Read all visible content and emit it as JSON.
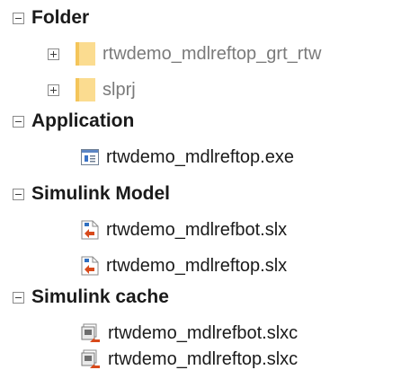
{
  "tree": {
    "groups": [
      {
        "label": "Folder",
        "expanded": true,
        "items": [
          {
            "label": "rtwdemo_mdlreftop_grt_rtw",
            "icon": "folder-icon",
            "expandable": true,
            "dimmed": true
          },
          {
            "label": "slprj",
            "icon": "folder-icon",
            "expandable": true,
            "dimmed": true
          }
        ]
      },
      {
        "label": "Application",
        "expanded": true,
        "items": [
          {
            "label": "rtwdemo_mdlreftop.exe",
            "icon": "application-icon",
            "expandable": false
          }
        ]
      },
      {
        "label": "Simulink Model",
        "expanded": true,
        "items": [
          {
            "label": "rtwdemo_mdlrefbot.slx",
            "icon": "simulink-model-icon",
            "expandable": false
          },
          {
            "label": "rtwdemo_mdlreftop.slx",
            "icon": "simulink-model-icon",
            "expandable": false
          }
        ]
      },
      {
        "label": "Simulink cache",
        "expanded": true,
        "items": [
          {
            "label": "rtwdemo_mdlrefbot.slxc",
            "icon": "simulink-cache-icon",
            "expandable": false
          },
          {
            "label": "rtwdemo_mdlreftop.slxc",
            "icon": "simulink-cache-icon",
            "expandable": false
          }
        ]
      }
    ],
    "colors": {
      "folder": "#fbdc90",
      "dimmed_text": "#7a7a7a",
      "model_arrow": "#d84a1b",
      "model_accent": "#2f6fc0"
    }
  }
}
